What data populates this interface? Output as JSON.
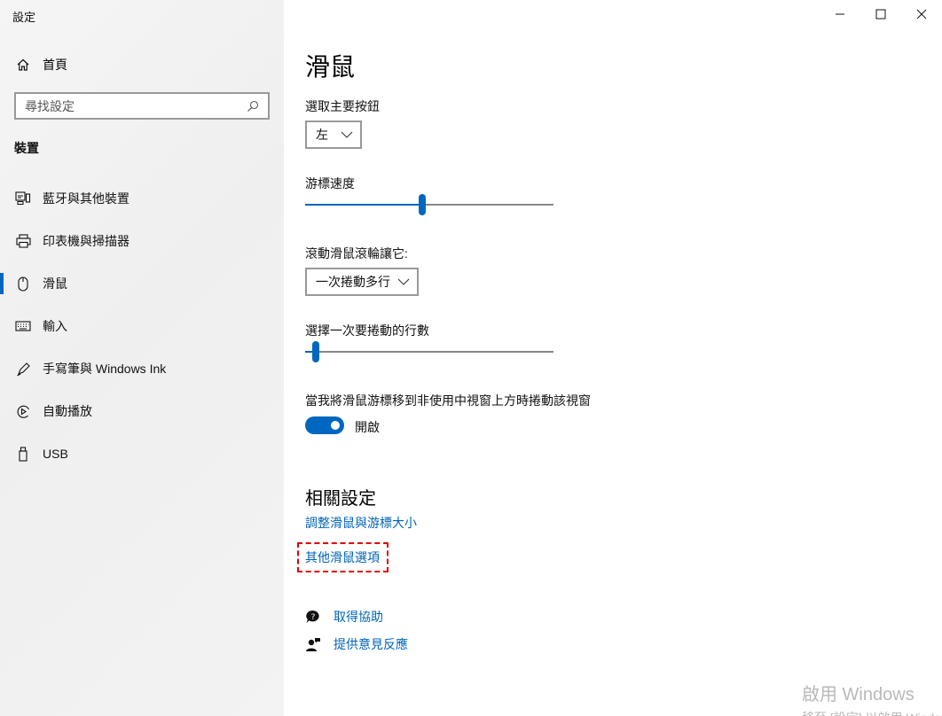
{
  "window": {
    "title": "設定"
  },
  "sidebar": {
    "home_label": "首頁",
    "search_placeholder": "尋找設定",
    "section_label": "裝置",
    "items": [
      {
        "label": "藍牙與其他裝置",
        "icon": "bluetooth-devices-icon"
      },
      {
        "label": "印表機與掃描器",
        "icon": "printer-icon"
      },
      {
        "label": "滑鼠",
        "icon": "mouse-icon",
        "active": true
      },
      {
        "label": "輸入",
        "icon": "keyboard-icon"
      },
      {
        "label": "手寫筆與 Windows Ink",
        "icon": "pen-icon"
      },
      {
        "label": "自動播放",
        "icon": "autoplay-icon"
      },
      {
        "label": "USB",
        "icon": "usb-icon"
      }
    ]
  },
  "main": {
    "title": "滑鼠",
    "primary_button": {
      "label": "選取主要按鈕",
      "value": "左"
    },
    "cursor_speed": {
      "label": "游標速度",
      "level_fraction": 0.47
    },
    "scroll_wheel": {
      "label": "滾動滑鼠滾輪讓它:",
      "value": "一次捲動多行"
    },
    "lines_to_scroll": {
      "label": "選擇一次要捲動的行數",
      "level_fraction": 0.03
    },
    "inactive_scroll": {
      "label": "當我將滑鼠游標移到非使用中視窗上方時捲動該視窗",
      "state": "開啟",
      "on": true
    },
    "related": {
      "title": "相關設定",
      "links": [
        "調整滑鼠與游標大小",
        "其他滑鼠選項"
      ]
    },
    "help": {
      "get_help": "取得協助",
      "feedback": "提供意見反應"
    }
  },
  "watermark": {
    "line1": "啟用 Windows",
    "line2": "移至 [設定] 以啟用 Windows"
  },
  "colors": {
    "accent": "#0067c0",
    "link": "#0064b4",
    "highlight": "#e00000"
  }
}
